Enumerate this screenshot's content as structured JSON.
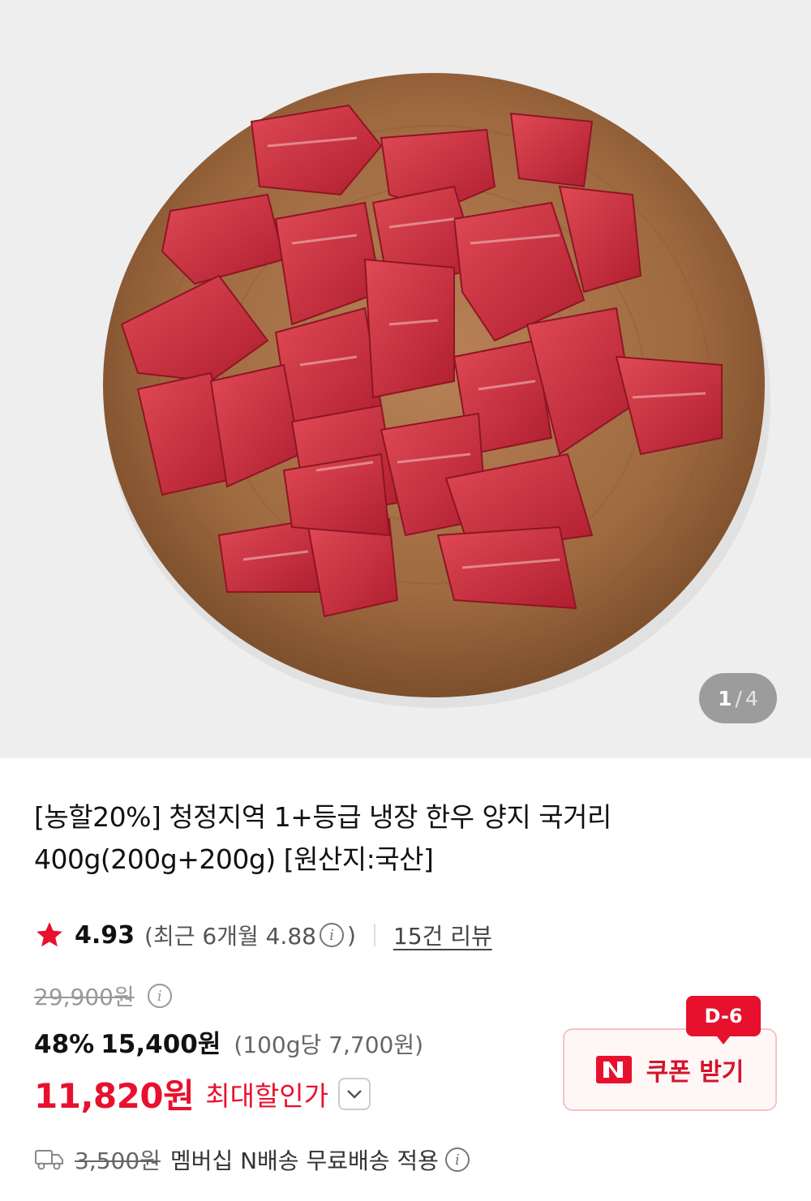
{
  "gallery": {
    "current": "1",
    "separator": "/",
    "total": "4"
  },
  "product": {
    "title": "[농할20%] 청정지역 1+등급 냉장 한우 양지 국거리 400g(200g+200g) [원산지:국산]"
  },
  "rating": {
    "score": "4.93",
    "recent": "(최근 6개월 4.88",
    "recent_close": ")",
    "review_link": "15건 리뷰"
  },
  "price": {
    "original": "29,900원",
    "discount_rate": "48%",
    "sale": "15,400원",
    "unit": "(100g당 7,700원)",
    "max_discount_price": "11,820원",
    "max_discount_label": "최대할인가"
  },
  "shipping": {
    "original_fee": "3,500원",
    "text": "멤버십 N배송 무료배송 적용"
  },
  "coupon": {
    "badge": "D-6",
    "label": "쿠폰 받기",
    "logo_text": "N"
  },
  "colors": {
    "accent_red": "#e8112d",
    "hero_bg": "#eeeeee",
    "board": "#a9744a"
  },
  "icons": {
    "star": "star-icon",
    "info": "info-icon",
    "chevron": "chevron-down-icon",
    "truck": "truck-icon",
    "coupon_logo": "naver-n-icon"
  }
}
